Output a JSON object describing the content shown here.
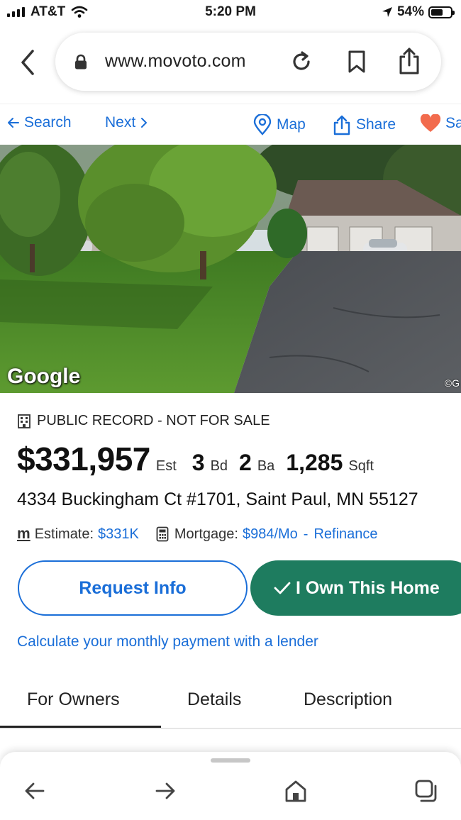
{
  "status_bar": {
    "carrier": "AT&T",
    "time": "5:20 PM",
    "battery": "54%"
  },
  "browser": {
    "url": "www.movoto.com"
  },
  "site_nav": {
    "search": "Search",
    "next": "Next",
    "map": "Map",
    "share": "Share",
    "save": "Sa"
  },
  "photo": {
    "attribution": "Google",
    "copyright": "©G"
  },
  "listing": {
    "record_label": "PUBLIC RECORD - NOT FOR SALE",
    "price": "$331,957",
    "price_suffix": "Est",
    "beds": "3",
    "beds_unit": "Bd",
    "baths": "2",
    "baths_unit": "Ba",
    "sqft": "1,285",
    "sqft_unit": "Sqft",
    "address": "4334 Buckingham Ct #1701, Saint Paul, MN 55127",
    "estimate_label": "Estimate:",
    "estimate_value": "$331K",
    "mortgage_label": "Mortgage:",
    "mortgage_value": "$984/Mo",
    "separator": "-",
    "refinance": "Refinance"
  },
  "actions": {
    "request_info": "Request Info",
    "own_home": "I Own This Home",
    "calc_link": "Calculate your monthly payment with a lender"
  },
  "tabs": [
    {
      "label": "For Owners",
      "active": true
    },
    {
      "label": "Details",
      "active": false
    },
    {
      "label": "Description",
      "active": false
    }
  ],
  "colors": {
    "link_blue": "#1a6ed8",
    "own_green": "#1e7c5f",
    "heart": "#f26b4d"
  }
}
